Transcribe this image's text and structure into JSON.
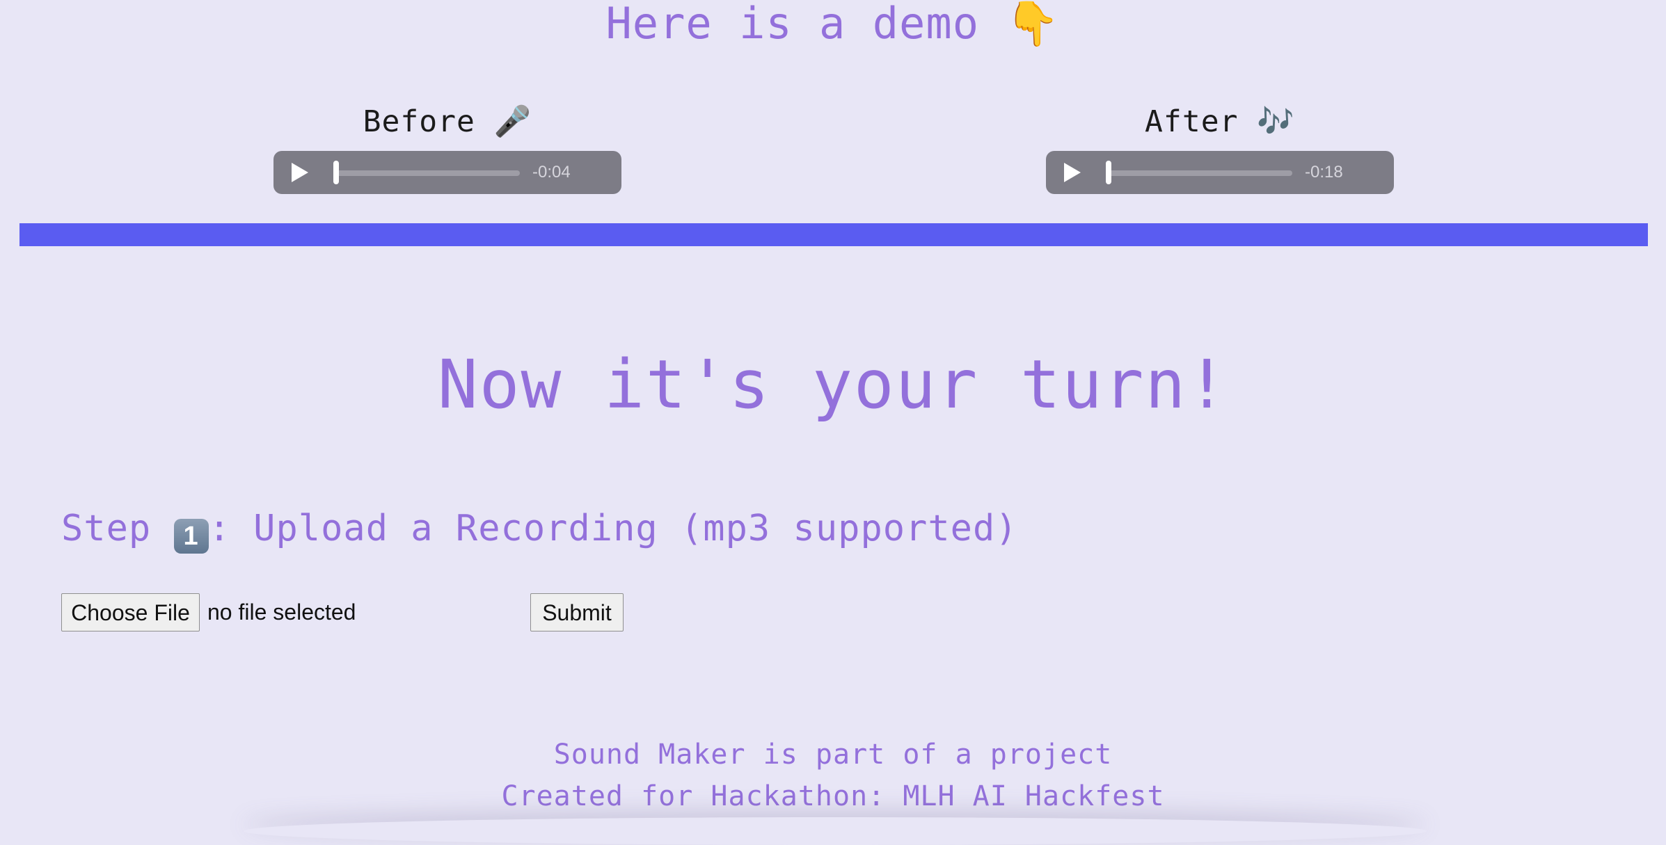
{
  "demo": {
    "title": "Here is a demo",
    "title_icon": "👇",
    "before": {
      "label": "Before",
      "icon": "🎤",
      "time_remaining": "-0:04",
      "progress": 0
    },
    "after": {
      "label": "After",
      "icon": "🎶",
      "time_remaining": "-0:18",
      "progress": 0
    }
  },
  "upload": {
    "heading": "Now it's your turn!",
    "step_prefix": "Step",
    "step_number": "1",
    "step_text": ": Upload a Recording (mp3 supported)",
    "choose_file_label": "Choose File",
    "file_status": "no file selected",
    "submit_label": "Submit"
  },
  "footer": {
    "line1": "Sound Maker is part of a project",
    "line2": "Created for Hackathon: MLH AI Hackfest"
  },
  "colors": {
    "background": "#e8e6f6",
    "accent_text": "#9370db",
    "divider": "#5a5cf1",
    "player_bg": "#7d7c86"
  }
}
